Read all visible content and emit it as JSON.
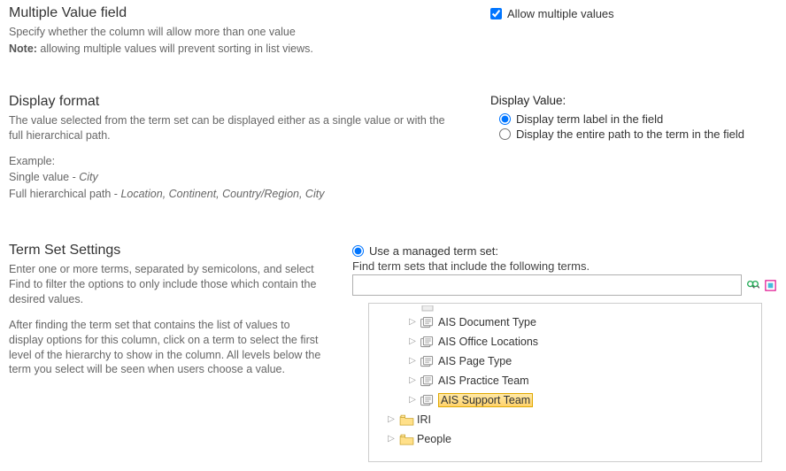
{
  "section1": {
    "heading": "Multiple Value field",
    "desc1": "Specify whether the column will allow more than one value",
    "desc2_prefix": "Note:",
    "desc2_rest": " allowing multiple values will prevent sorting in list views.",
    "checkbox_label": "Allow multiple values",
    "checkbox_checked": true
  },
  "section2": {
    "heading": "Display format",
    "desc1": "The value selected from the term set can be displayed either as a single value or with the full hierarchical path.",
    "example_label": "Example:",
    "single_prefix": "Single value - ",
    "single_value": "City",
    "full_prefix": "Full hierarchical path - ",
    "full_value": "Location, Continent, Country/Region, City",
    "right_heading": "Display Value:",
    "radio1": "Display term label in the field",
    "radio2": "Display the entire path to the term in the field"
  },
  "section3": {
    "heading": "Term Set Settings",
    "desc1": "Enter one or more terms, separated by semicolons, and select Find to filter the options to only include those which contain the desired values.",
    "desc2": "After finding the term set that contains the list of values to display options for this column, click on a term to select the first level of the hierarchy to show in the column. All levels below the term you select will be seen when users choose a value.",
    "radio_label": "Use a managed term set:",
    "hint": "Find term sets that include the following terms.",
    "search_value": "",
    "tree": {
      "items": [
        {
          "indent": 2,
          "type": "termset",
          "label": "AIS Document Type",
          "selected": false
        },
        {
          "indent": 2,
          "type": "termset",
          "label": "AIS Office Locations",
          "selected": false
        },
        {
          "indent": 2,
          "type": "termset",
          "label": "AIS Page Type",
          "selected": false
        },
        {
          "indent": 2,
          "type": "termset",
          "label": "AIS Practice Team",
          "selected": false
        },
        {
          "indent": 2,
          "type": "termset",
          "label": "AIS Support Team",
          "selected": true
        },
        {
          "indent": 1,
          "type": "folder",
          "label": "IRI",
          "selected": false
        },
        {
          "indent": 1,
          "type": "folder",
          "label": "People",
          "selected": false
        }
      ]
    }
  },
  "icons": {
    "find": "find-icon",
    "reset": "reset-icon"
  }
}
